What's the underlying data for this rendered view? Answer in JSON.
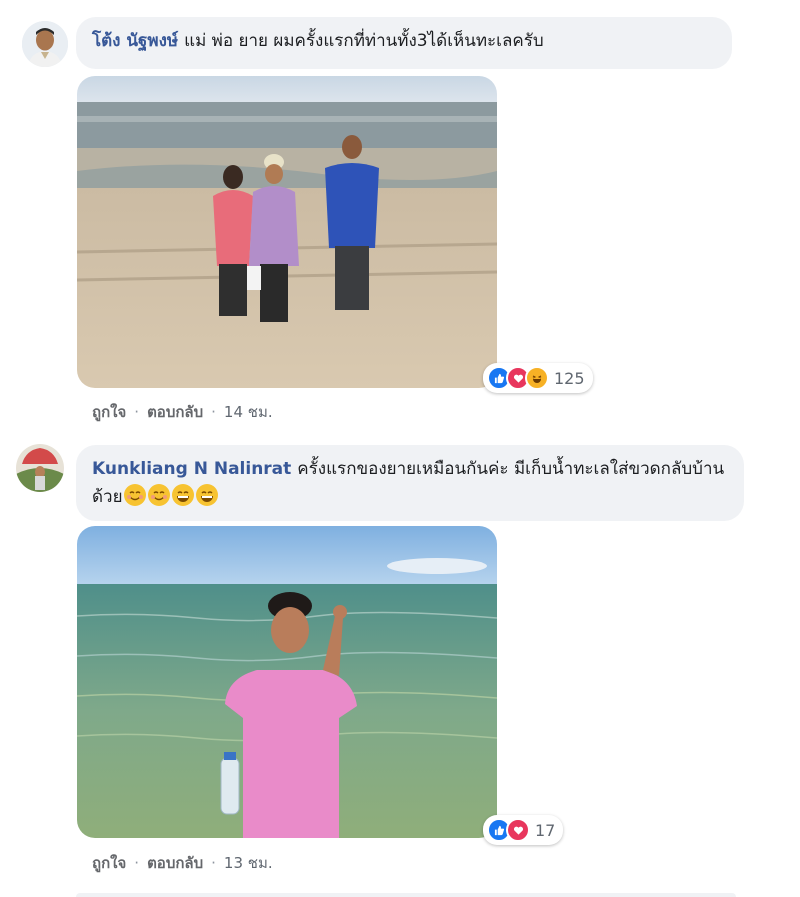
{
  "comments": [
    {
      "author": "โต้ง นัฐพงษ์",
      "text": "แม่ พ่อ ยาย ผมครั้งแรกที่ท่านทั้ง3ได้เห็นทะเลครับ",
      "reaction_count": "125",
      "reactions": [
        "like-icon",
        "love-icon",
        "haha-icon"
      ],
      "like_label": "ถูกใจ",
      "reply_label": "ตอบกลับ",
      "time": "14 ชม."
    },
    {
      "author": "Kunkliang N Nalinrat",
      "text": "ครั้งแรกของยายเหมือนกันค่ะ มีเก็บน้ำทะเลใส่ขวดกลับบ้านด้วย",
      "emojis": [
        "smiling-face-icon",
        "smiling-face-icon",
        "grinning-face-icon",
        "grinning-face-icon"
      ],
      "reaction_count": "17",
      "reactions": [
        "like-icon",
        "love-icon"
      ],
      "like_label": "ถูกใจ",
      "reply_label": "ตอบกลับ",
      "time": "13 ชม."
    }
  ],
  "colors": {
    "author": "#385898",
    "bubble": "#f0f2f5",
    "like": "#1877f2",
    "love": "#e8365d",
    "haha": "#f7b125"
  }
}
